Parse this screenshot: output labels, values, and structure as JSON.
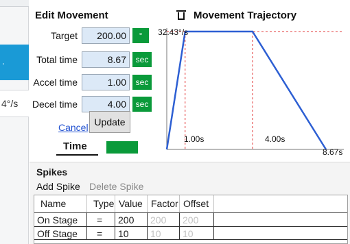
{
  "left_strip": {
    "selected_char": ".",
    "value_text": "4°/s"
  },
  "edit_movement": {
    "title": "Edit Movement",
    "fields": [
      {
        "label": "Target",
        "value": "200.00",
        "unit": "°"
      },
      {
        "label": "Total time",
        "value": "8.67",
        "unit": "sec"
      },
      {
        "label": "Accel time",
        "value": "1.00",
        "unit": "sec"
      },
      {
        "label": "Decel time",
        "value": "4.00",
        "unit": "sec"
      }
    ],
    "cancel_label": "Cancel",
    "update_label": "Update",
    "time_label": "Time",
    "time_toggle_on": true
  },
  "trajectory": {
    "title": "Movement Trajectory",
    "velocity_label": "32.43°/s",
    "time_labels": [
      "1.00s",
      "4.00s",
      "8.67s"
    ]
  },
  "chart_data": {
    "type": "line",
    "x": [
      0,
      1.0,
      4.67,
      8.67
    ],
    "y": [
      0,
      32.43,
      32.43,
      0
    ],
    "ylabel": "32.43°/s",
    "xlim": [
      0,
      8.67
    ],
    "ylim": [
      0,
      32.43
    ],
    "reference_lines": {
      "vertical": [
        1.0,
        4.67
      ],
      "horizontal": [
        32.43
      ]
    },
    "x_annotations": [
      "1.00s",
      "4.00s",
      "8.67s"
    ],
    "colors": {
      "line": "#2d5fd3",
      "reference": "#e33b3b"
    }
  },
  "spikes": {
    "title": "Spikes",
    "add_label": "Add Spike",
    "delete_label": "Delete Spike",
    "columns": [
      "Name",
      "Type",
      "Value",
      "Factor",
      "Offset"
    ],
    "rows": [
      {
        "name": "On Stage",
        "type": "=",
        "value": "200",
        "factor": "200",
        "offset": "200"
      },
      {
        "name": "Off Stage",
        "type": "=",
        "value": "10",
        "factor": "10",
        "offset": "10"
      }
    ]
  },
  "colors": {
    "accent_blue": "#1a9ad6",
    "unit_green": "#0a9a3a",
    "input_bg": "#dce9f7",
    "link": "#1f4fd0"
  }
}
